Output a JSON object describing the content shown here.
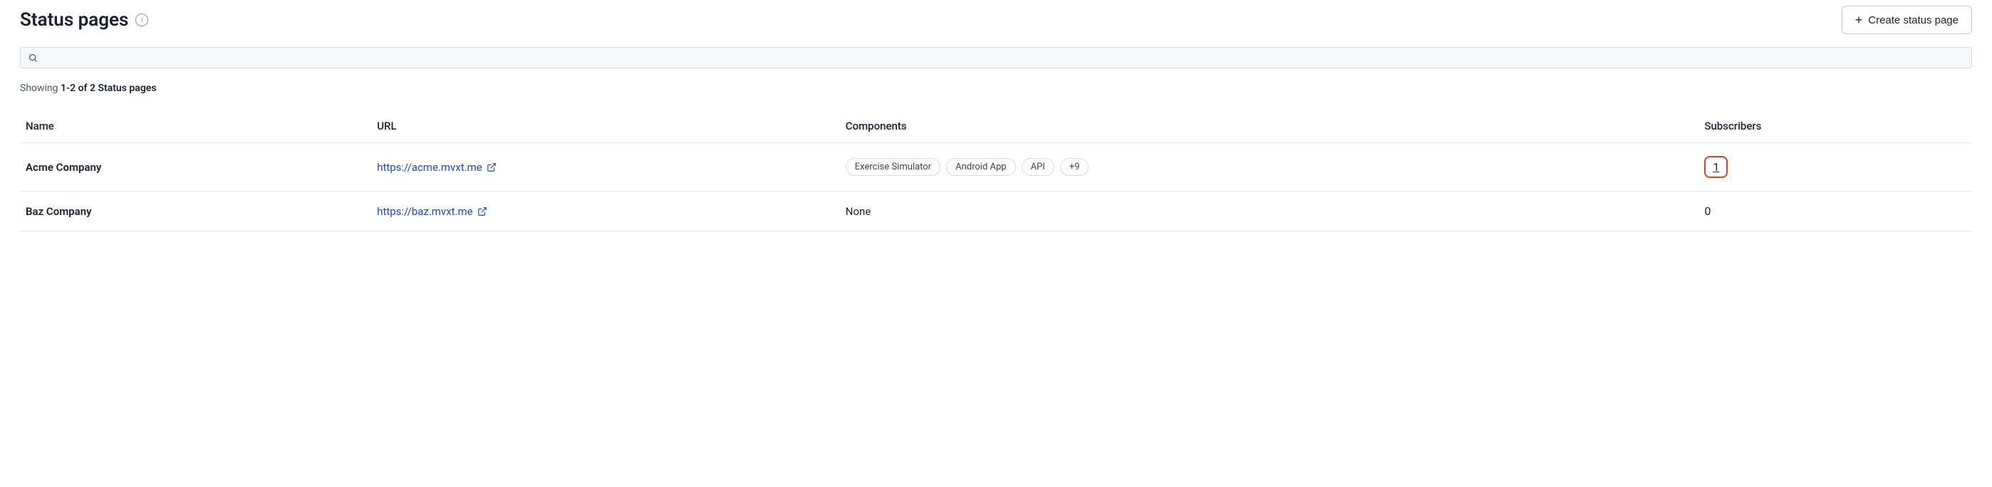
{
  "header": {
    "title": "Status pages",
    "create_button": "Create status page"
  },
  "search": {
    "placeholder": ""
  },
  "summary": {
    "prefix": "Showing ",
    "range": "1-2 of 2 Status pages"
  },
  "table": {
    "headers": {
      "name": "Name",
      "url": "URL",
      "components": "Components",
      "subscribers": "Subscribers"
    },
    "rows": [
      {
        "name": "Acme Company",
        "url": "https://acme.mvxt.me",
        "components": [
          "Exercise Simulator",
          "Android App",
          "API"
        ],
        "overflow": "+9",
        "subscribers": "1",
        "highlighted": true
      },
      {
        "name": "Baz Company",
        "url": "https://baz.mvxt.me",
        "components": [],
        "components_none": "None",
        "subscribers": "0",
        "highlighted": false
      }
    ]
  }
}
